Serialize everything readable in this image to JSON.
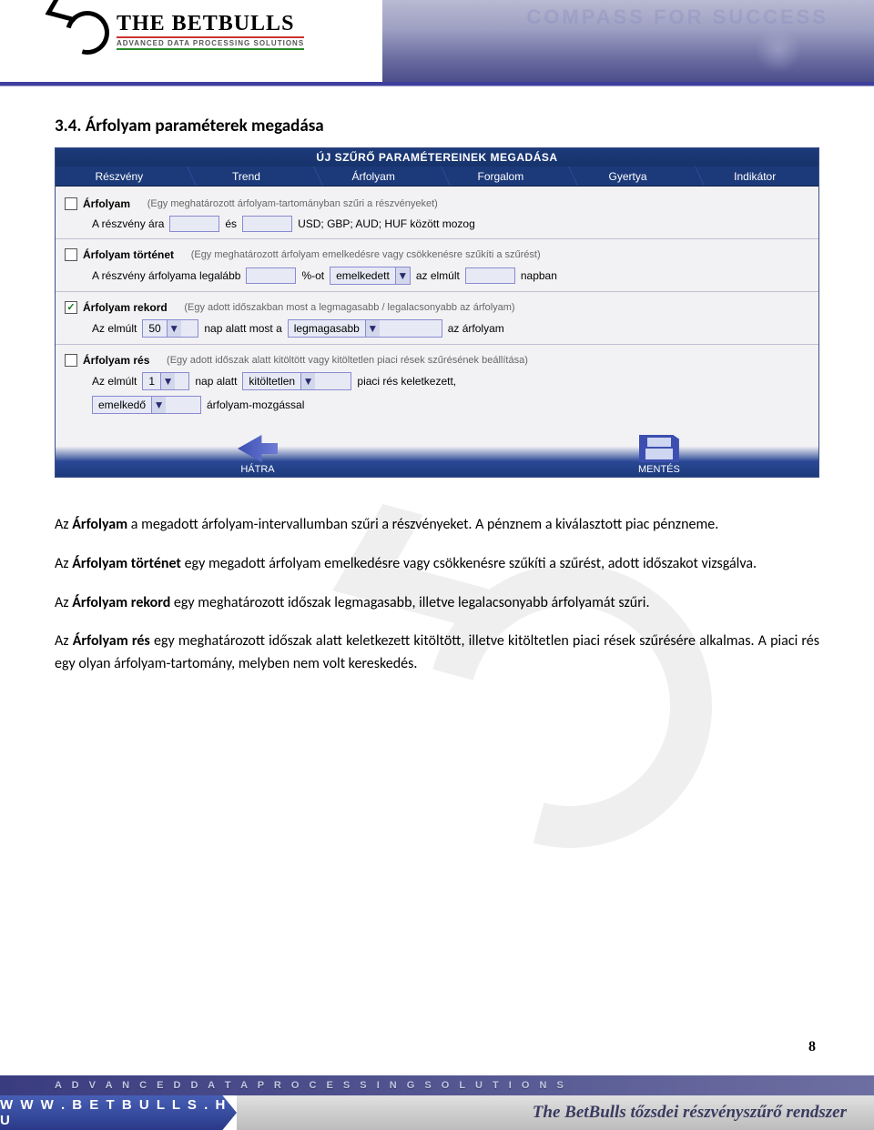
{
  "header": {
    "brand": "THE BETBULLS",
    "brand_sub": "ADVANCED DATA PROCESSING SOLUTIONS",
    "compass_ghost": "COMPASS FOR SUCCESS"
  },
  "section_title": "3.4. Árfolyam paraméterek megadása",
  "panel": {
    "title": "ÚJ SZŰRŐ PARAMÉTEREINEK MEGADÁSA",
    "tabs": [
      "Részvény",
      "Trend",
      "Árfolyam",
      "Forgalom",
      "Gyertya",
      "Indikátor"
    ],
    "grp1": {
      "checked": false,
      "label": "Árfolyam",
      "hint": "(Egy meghatározott árfolyam-tartományban szűri a részvényeket)",
      "line_pre": "A részvény ára",
      "line_mid": "és",
      "line_post": "USD; GBP; AUD; HUF között mozog"
    },
    "grp2": {
      "checked": false,
      "label": "Árfolyam történet",
      "hint": "(Egy meghatározott árfolyam emelkedésre vagy csökkenésre szűkíti a szűrést)",
      "line_pre": "A részvény árfolyama legalább",
      "pct": "%-ot",
      "select": "emelkedett",
      "mid": "az elmúlt",
      "post": "napban"
    },
    "grp3": {
      "checked": true,
      "label": "Árfolyam rekord",
      "hint": "(Egy adott időszakban most a legmagasabb / legalacsonyabb az árfolyam)",
      "line_pre": "Az elmúlt",
      "days": "50",
      "mid": "nap alatt most a",
      "select": "legmagasabb",
      "post": "az árfolyam"
    },
    "grp4": {
      "checked": false,
      "label": "Árfolyam rés",
      "hint": "(Egy adott időszak alatt kitöltött vagy kitöltetlen piaci rések szűrésének beállítása)",
      "line_pre": "Az elmúlt",
      "days": "1",
      "mid": "nap alatt",
      "select": "kitöltetlen",
      "post": "piaci rés keletkezett,",
      "select2": "emelkedő",
      "post2": "árfolyam-mozgással"
    },
    "footer": {
      "back": "HÁTRA",
      "save": "MENTÉS"
    }
  },
  "desc": {
    "p1a": "Az ",
    "p1b": "Árfolyam",
    "p1c": " a megadott árfolyam-intervallumban szűri a részvényeket. A pénznem a kiválasztott piac pénzneme.",
    "p2a": "Az ",
    "p2b": "Árfolyam történet",
    "p2c": " egy megadott árfolyam emelkedésre vagy csökkenésre szűkíti a szűrést, adott időszakot vizsgálva.",
    "p3a": "Az ",
    "p3b": "Árfolyam rekord",
    "p3c": " egy meghatározott időszak legmagasabb, illetve legalacsonyabb árfolyamát szűri.",
    "p4a": "Az ",
    "p4b": "Árfolyam rés",
    "p4c": " egy meghatározott időszak alatt keletkezett kitöltött, illetve kitöltetlen piaci rések szűrésére alkalmas. A piaci rés egy olyan árfolyam-tartomány, melyben nem volt kereskedés."
  },
  "page_number": "8",
  "footer": {
    "strip": "A D V A N C E D   D A T A   P R O C E S S I N G   S O L U T I O N S",
    "url": "W W W . B E T B U L L S . H U",
    "title": "The BetBulls tőzsdei részvényszűrő rendszer"
  }
}
